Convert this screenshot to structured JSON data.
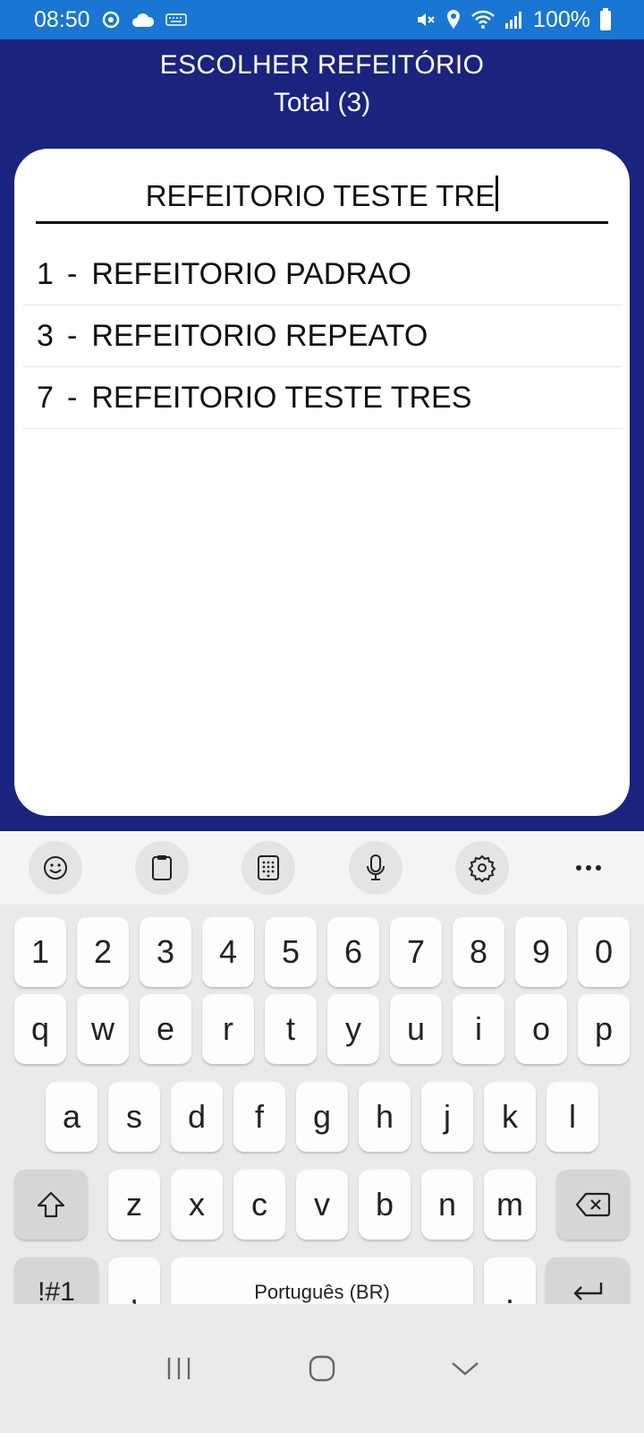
{
  "status": {
    "time": "08:50",
    "battery": "100%"
  },
  "header": {
    "title": "ESCOLHER REFEITÓRIO",
    "total": "Total (3)"
  },
  "search": {
    "value": "REFEITORIO TESTE TRE"
  },
  "list": [
    {
      "number": "1",
      "dash": "-",
      "name": "REFEITORIO PADRAO"
    },
    {
      "number": "3",
      "dash": "-",
      "name": "REFEITORIO REPEATO"
    },
    {
      "number": "7",
      "dash": "-",
      "name": "REFEITORIO TESTE TRES"
    }
  ],
  "keyboard": {
    "numbers": [
      "1",
      "2",
      "3",
      "4",
      "5",
      "6",
      "7",
      "8",
      "9",
      "0"
    ],
    "row1": [
      "q",
      "w",
      "e",
      "r",
      "t",
      "y",
      "u",
      "i",
      "o",
      "p"
    ],
    "row2": [
      "a",
      "s",
      "d",
      "f",
      "g",
      "h",
      "j",
      "k",
      "l"
    ],
    "row3": [
      "z",
      "x",
      "c",
      "v",
      "b",
      "n",
      "m"
    ],
    "symbols": "!#1",
    "comma": ",",
    "space": "Português (BR)",
    "period": "."
  },
  "colors": {
    "status_bar": "#1976d2",
    "header_bg": "#1a237e"
  },
  "icons": [
    "emoji-icon",
    "clipboard-icon",
    "keypad-icon",
    "mic-icon",
    "settings-icon",
    "more-icon",
    "shift-icon",
    "backspace-icon",
    "enter-icon",
    "recents-icon",
    "home-icon",
    "back-icon"
  ]
}
